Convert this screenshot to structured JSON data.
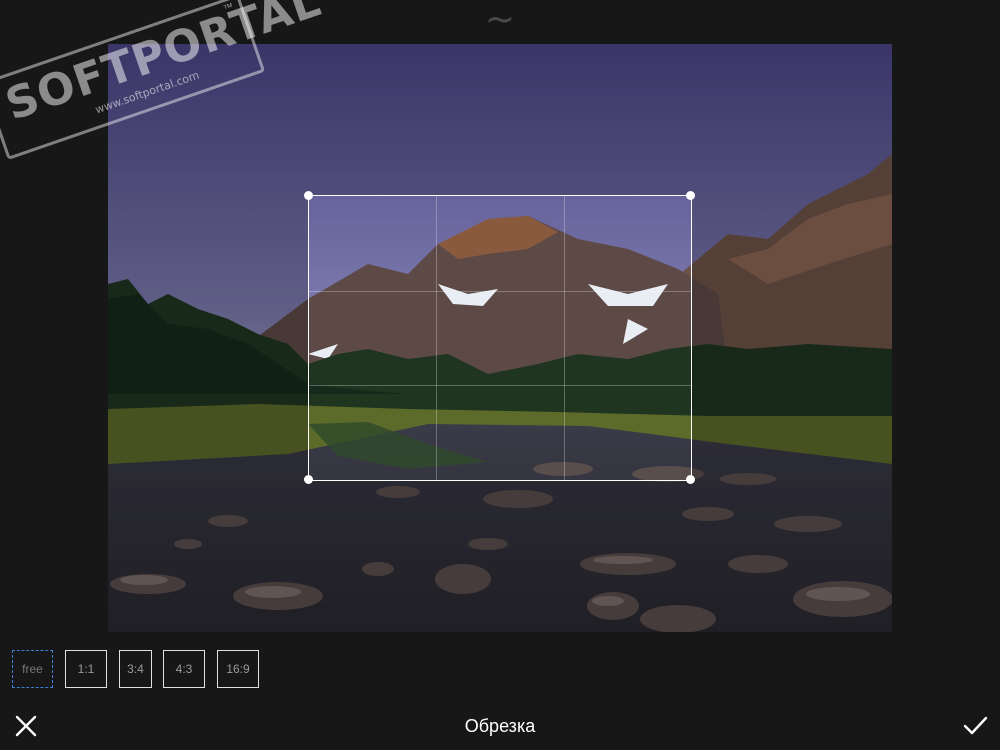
{
  "top_handle": {
    "glyph": "~",
    "icon": "drag-handle-icon"
  },
  "watermark": {
    "brand": "SOFTPORTAL",
    "site": "www.softportal.com",
    "mark": "™"
  },
  "crop": {
    "grid": "rule-of-thirds"
  },
  "ratios": [
    {
      "label": "free",
      "active": true
    },
    {
      "label": "1:1",
      "active": false
    },
    {
      "label": "3:4",
      "active": false
    },
    {
      "label": "4:3",
      "active": false
    },
    {
      "label": "16:9",
      "active": false
    }
  ],
  "bottom_bar": {
    "title": "Обрезка",
    "close_icon": "close-icon",
    "confirm_icon": "checkmark-icon"
  },
  "colors": {
    "accent": "#3d7fd6",
    "background": "#171717",
    "crop_border": "#ffffff"
  }
}
